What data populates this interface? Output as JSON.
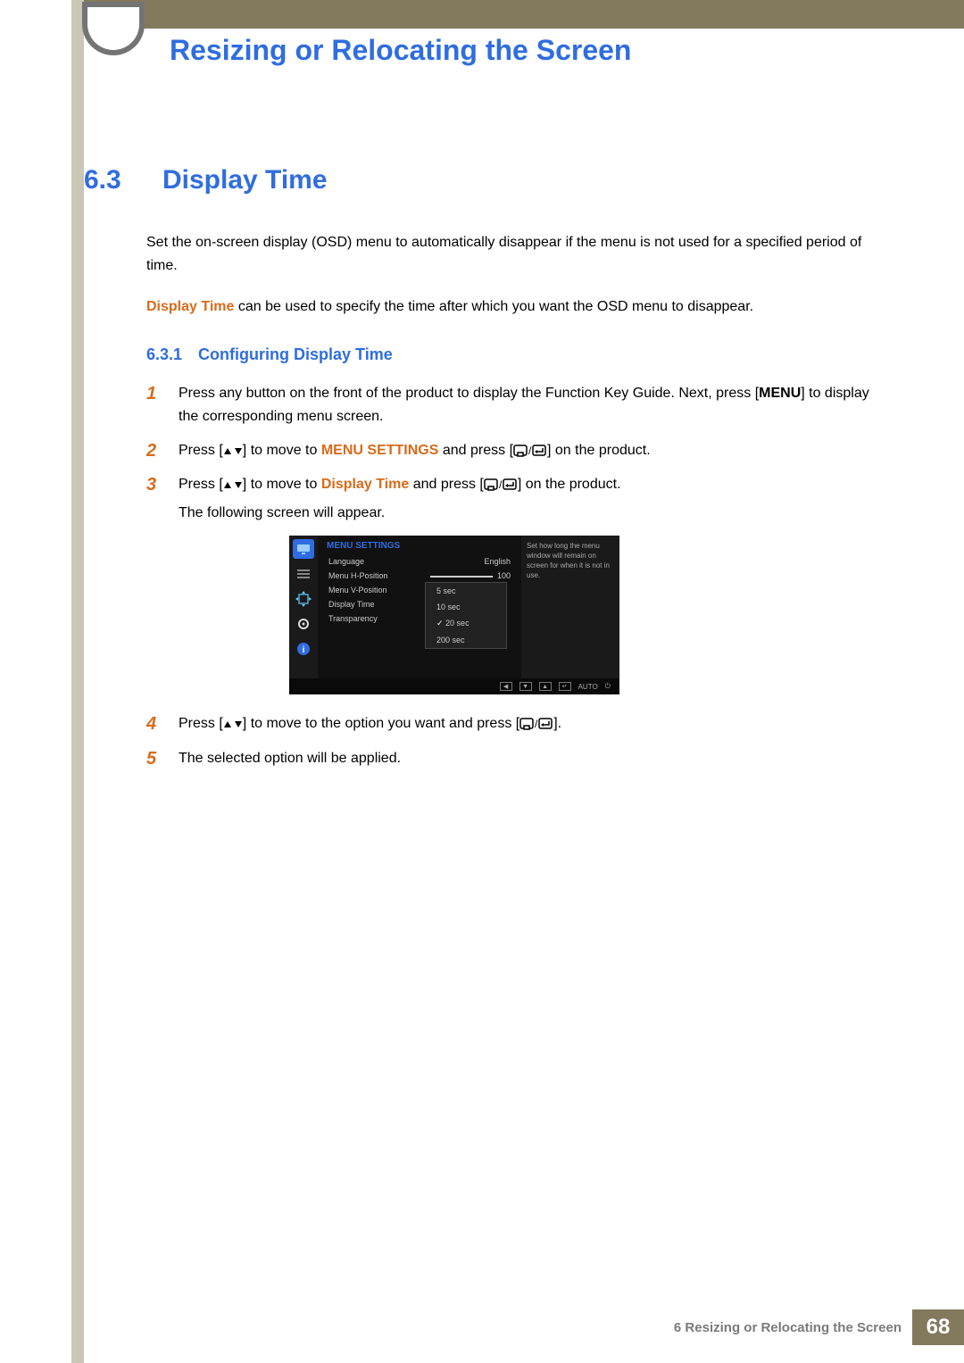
{
  "chapter_title": "Resizing or Relocating the Screen",
  "section": {
    "num": "6.3",
    "title": "Display Time"
  },
  "intro1": "Set the on-screen display (OSD) menu to automatically disappear if the menu is not used for a specified period of time.",
  "intro2_bold": "Display Time",
  "intro2_rest": " can be used to specify the time after which you want the OSD menu to disappear.",
  "subsection": {
    "num": "6.3.1",
    "title": "Configuring Display Time"
  },
  "steps": {
    "s1a": "Press any button on the front of the product to display the Function Key Guide. Next, press [",
    "s1_menu": "MENU",
    "s1b": "] to display the corresponding menu screen.",
    "s2a": "Press [",
    "s2b": "] to move to ",
    "s2_target": "MENU SETTINGS",
    "s2c": " and press [",
    "s2d": "] on the product.",
    "s3a": "Press [",
    "s3b": "] to move to ",
    "s3_target": "Display Time",
    "s3c": " and press [",
    "s3d": "] on the product.",
    "s3_follow": "The following screen will appear.",
    "s4a": "Press [",
    "s4b": "] to move to the option you want and press [",
    "s4c": "].",
    "s5": "The selected option will be applied."
  },
  "osd": {
    "title": "MENU SETTINGS",
    "rows": {
      "language_label": "Language",
      "language_val": "English",
      "hpos_label": "Menu H-Position",
      "hpos_val": "100",
      "vpos_label": "Menu V-Position",
      "dtime_label": "Display Time",
      "transp_label": "Transparency"
    },
    "options": {
      "o1": "5 sec",
      "o2": "10 sec",
      "o3": "20 sec",
      "o4": "200 sec"
    },
    "help": "Set how long the menu window will remain on screen for when it is not in use.",
    "auto": "AUTO"
  },
  "footer": {
    "text": "6 Resizing or Relocating the Screen",
    "page": "68"
  }
}
